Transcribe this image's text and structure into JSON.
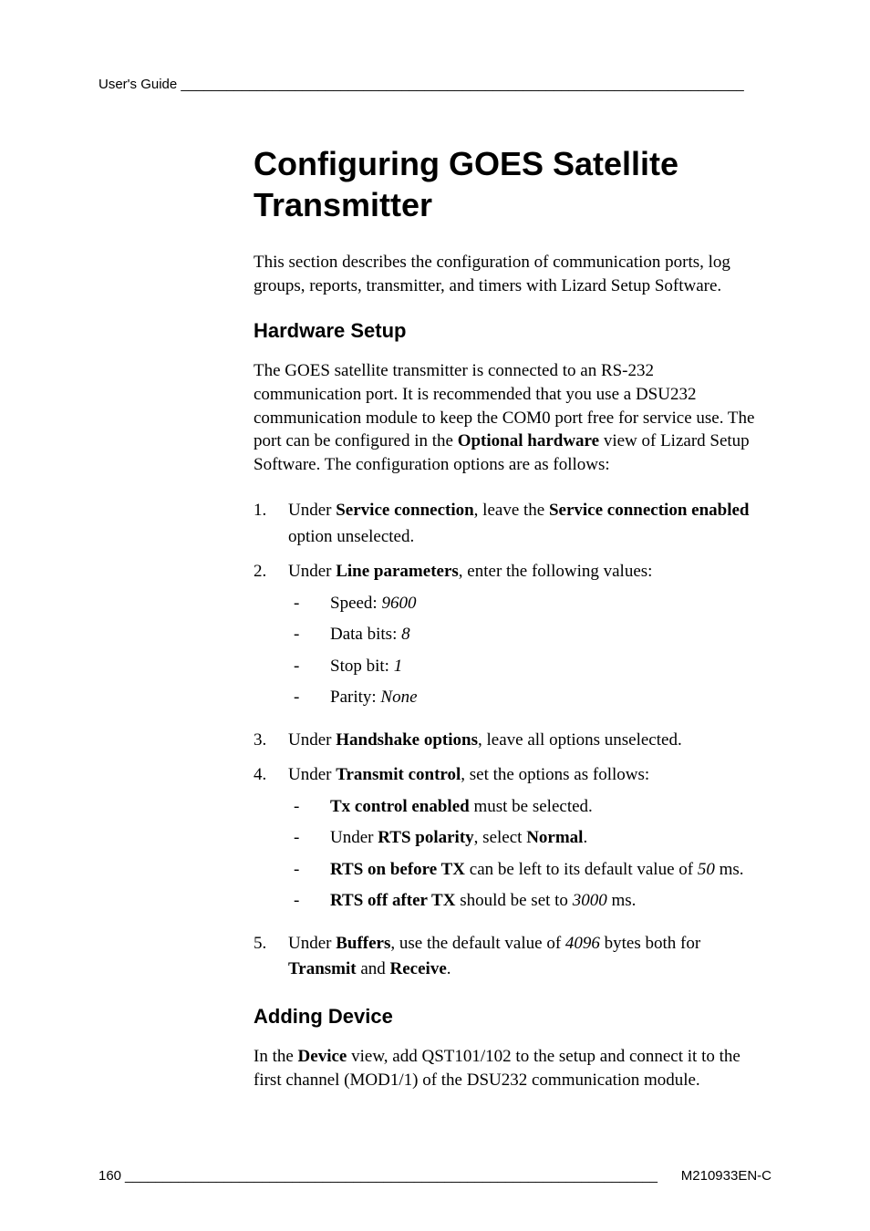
{
  "header": {
    "running_head": "User's Guide __________________________________________________________________________"
  },
  "title": "Configuring GOES Satellite Transmitter",
  "intro": "This section describes the configuration of communication ports, log groups, reports, transmitter, and timers with Lizard Setup Software.",
  "hardware": {
    "heading": "Hardware Setup",
    "para_pre": "The GOES satellite transmitter is connected to an RS-232 communication port. It is recommended that you use a DSU232 communication module to keep the COM0 port free for service use. The port can be configured in the ",
    "para_b1": "Optional hardware",
    "para_post": " view of Lizard Setup Software. The configuration options are as follows:",
    "step1": {
      "num": "1.",
      "pre": "Under ",
      "b1": "Service connection",
      "mid": ", leave the ",
      "b2": "Service connection enabled",
      "post": " option unselected."
    },
    "step2": {
      "num": "2.",
      "pre": "Under ",
      "b1": "Line parameters",
      "post": ", enter the following values:",
      "items": {
        "speed_label": "Speed: ",
        "speed_val": "9600",
        "databits_label": "Data bits: ",
        "databits_val": "8",
        "stopbit_label": "Stop bit: ",
        "stopbit_val": "1",
        "parity_label": "Parity: ",
        "parity_val": "None"
      }
    },
    "step3": {
      "num": "3.",
      "pre": "Under ",
      "b1": "Handshake options",
      "post": ", leave all options unselected."
    },
    "step4": {
      "num": "4.",
      "pre": "Under ",
      "b1": "Transmit control",
      "post": ", set the options as follows:",
      "items": {
        "a_b": "Tx control enabled",
        "a_post": " must be selected.",
        "b_pre": "Under ",
        "b_b1": "RTS polarity",
        "b_mid": ", select ",
        "b_b2": "Normal",
        "b_post": ".",
        "c_b": "RTS on before TX",
        "c_mid": " can be left to its default value of ",
        "c_i": "50",
        "c_post": " ms.",
        "d_b": "RTS off after TX",
        "d_mid": " should be set to ",
        "d_i": "3000",
        "d_post": " ms."
      }
    },
    "step5": {
      "num": "5.",
      "pre": "Under ",
      "b1": "Buffers",
      "mid1": ", use the default value of ",
      "i1": "4096",
      "mid2": " bytes both for ",
      "b2": "Transmit",
      "mid3": " and ",
      "b3": "Receive",
      "post": "."
    }
  },
  "adding": {
    "heading": "Adding Device",
    "para_pre": "In the ",
    "para_b1": "Device",
    "para_post": " view, add QST101/102 to the setup and connect it to the first channel (MOD1/1) of the DSU232 communication module."
  },
  "footer": {
    "page": "160",
    "fill": " ______________________________________________________________________ ",
    "doc": "M210933EN-C"
  },
  "dash": "-"
}
